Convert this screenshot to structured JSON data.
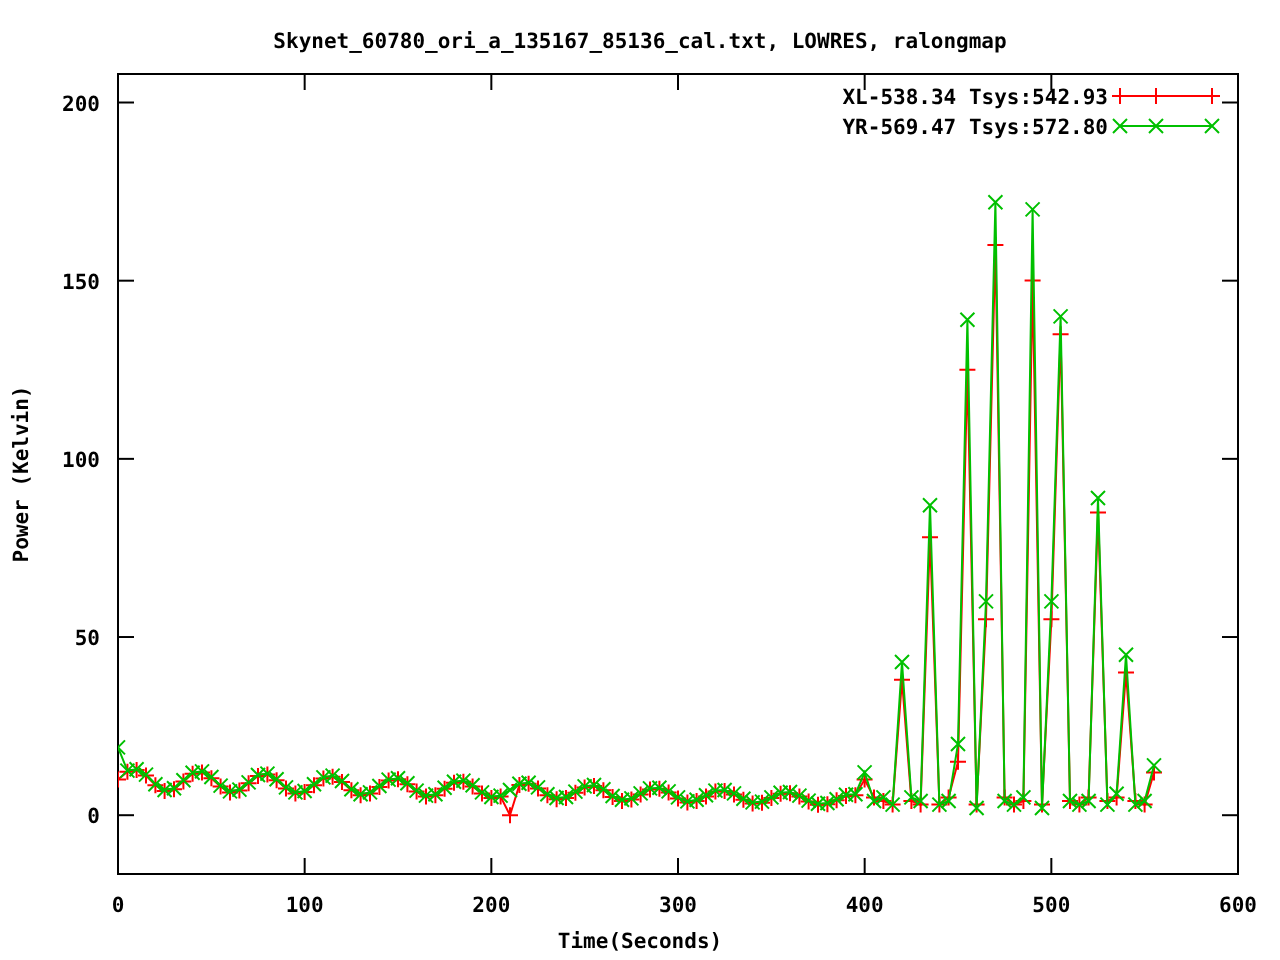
{
  "chart_data": {
    "type": "line",
    "title": "Skynet_60780_ori_a_135167_85136_cal.txt, LOWRES, ralongmap",
    "xlabel": "Time(Seconds)",
    "ylabel": "Power (Kelvin)",
    "x": [
      0,
      5,
      10,
      15,
      20,
      25,
      30,
      35,
      40,
      45,
      50,
      55,
      60,
      65,
      70,
      75,
      80,
      85,
      90,
      95,
      100,
      105,
      110,
      115,
      120,
      125,
      130,
      135,
      140,
      145,
      150,
      155,
      160,
      165,
      170,
      175,
      180,
      185,
      190,
      195,
      200,
      205,
      210,
      215,
      220,
      225,
      230,
      235,
      240,
      245,
      250,
      255,
      260,
      265,
      270,
      275,
      280,
      285,
      290,
      295,
      300,
      305,
      310,
      315,
      320,
      325,
      330,
      335,
      340,
      345,
      350,
      355,
      360,
      365,
      370,
      375,
      380,
      385,
      390,
      395,
      400,
      405,
      410,
      415,
      420,
      425,
      430,
      435,
      440,
      445,
      450,
      455,
      460,
      465,
      470,
      475,
      480,
      485,
      490,
      495,
      500,
      505,
      510,
      515,
      520,
      525,
      530,
      535,
      540,
      545,
      550,
      555
    ],
    "series": [
      {
        "name": "XL-538.34 Tsys:542.93",
        "color": "#ff0000",
        "values": [
          10,
          12.2,
          12.7,
          11.1,
          8.4,
          6.8,
          7.3,
          9.5,
          11.6,
          12,
          10.4,
          8,
          6.4,
          6.9,
          9,
          11,
          11.4,
          9.8,
          7.5,
          6.1,
          6.5,
          8.4,
          10.3,
          10.8,
          9.3,
          7,
          5.6,
          6.1,
          7.9,
          9.7,
          10.1,
          8.7,
          6.6,
          5.2,
          5.6,
          7.4,
          9.1,
          9.4,
          8.1,
          6.1,
          4.8,
          5.2,
          0,
          8.5,
          8.8,
          7.5,
          5.6,
          4.5,
          4.8,
          6.3,
          7.8,
          8.2,
          7,
          5.1,
          4,
          4.4,
          5.8,
          7.2,
          7.4,
          6.4,
          4.7,
          3.6,
          4,
          5.3,
          6.6,
          6.8,
          5.8,
          4.3,
          3.3,
          3.5,
          4.8,
          6,
          6.2,
          5.2,
          3.8,
          2.9,
          3.1,
          4.2,
          5.4,
          5.6,
          10,
          5,
          4,
          3,
          38,
          4,
          3,
          78,
          3,
          5,
          15,
          125,
          3,
          55,
          160,
          5,
          3,
          4,
          150,
          3,
          55,
          135,
          4,
          3,
          5,
          85,
          4,
          5,
          40,
          4,
          3,
          12
        ]
      },
      {
        "name": "YR-569.47 Tsys:572.80",
        "color": "#00c000",
        "values": [
          19,
          12.5,
          12.9,
          11.4,
          8.7,
          7.1,
          7.6,
          9.8,
          11.9,
          12.3,
          10.7,
          8.3,
          6.7,
          7.2,
          9.2,
          11.3,
          11.7,
          10.1,
          7.8,
          6.4,
          6.8,
          8.7,
          10.6,
          11.1,
          9.6,
          7.3,
          5.9,
          6.4,
          8.2,
          10,
          10.4,
          9,
          6.9,
          5.5,
          5.9,
          7.7,
          9.4,
          9.7,
          8.4,
          6.4,
          5.1,
          5.5,
          7.1,
          8.8,
          9.1,
          7.8,
          5.9,
          4.8,
          5.1,
          6.6,
          8.1,
          8.5,
          7.3,
          5.4,
          4.3,
          4.7,
          6.1,
          7.5,
          7.7,
          6.7,
          5,
          3.9,
          4.3,
          5.6,
          6.9,
          7.1,
          6.1,
          4.6,
          3.6,
          3.8,
          5,
          6.3,
          6.5,
          5.5,
          4.1,
          3.2,
          3.4,
          4.5,
          5.7,
          5.9,
          12,
          4,
          5,
          3,
          43,
          5,
          4,
          87,
          3,
          4,
          20,
          139,
          2,
          60,
          172,
          4,
          3,
          5,
          170,
          2,
          60,
          140,
          4,
          3,
          4,
          89,
          3,
          6,
          45,
          3,
          4,
          14
        ]
      }
    ],
    "legend": true,
    "xlim": [
      0,
      600
    ],
    "ylim": [
      -16.5,
      208
    ],
    "xticks": [
      0,
      100,
      200,
      300,
      400,
      500,
      600
    ],
    "yticks": [
      0,
      50,
      100,
      150,
      200
    ]
  }
}
